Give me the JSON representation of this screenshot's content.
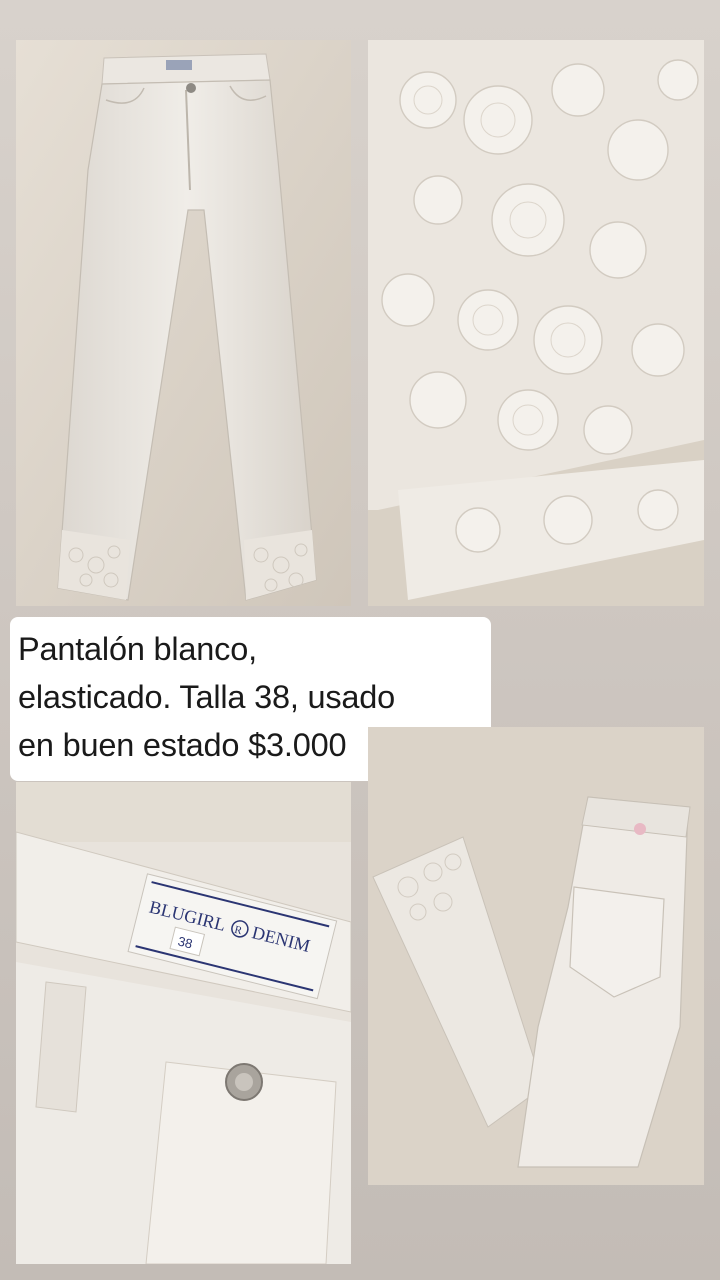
{
  "caption": {
    "lines": [
      "Pantalón blanco,",
      "elasticado. Talla 38, usado",
      "en buen estado $3.000"
    ]
  },
  "label": {
    "brand_left": "BLUGIRL",
    "brand_mark": "R",
    "brand_right": "DENIM",
    "size": "38"
  },
  "photos": [
    {
      "subject": "front view of white jeans with embroidered hems"
    },
    {
      "subject": "close-up of floral embroidery at hem"
    },
    {
      "subject": "waistband brand label and button"
    },
    {
      "subject": "back view of folded jeans with pocket"
    }
  ],
  "colors": {
    "background": "#d0c9c3",
    "fabric": "#ece8e2",
    "carpet": "#d9d1c6",
    "caption_bg": "#ffffff",
    "caption_text": "#1a1a1a"
  }
}
